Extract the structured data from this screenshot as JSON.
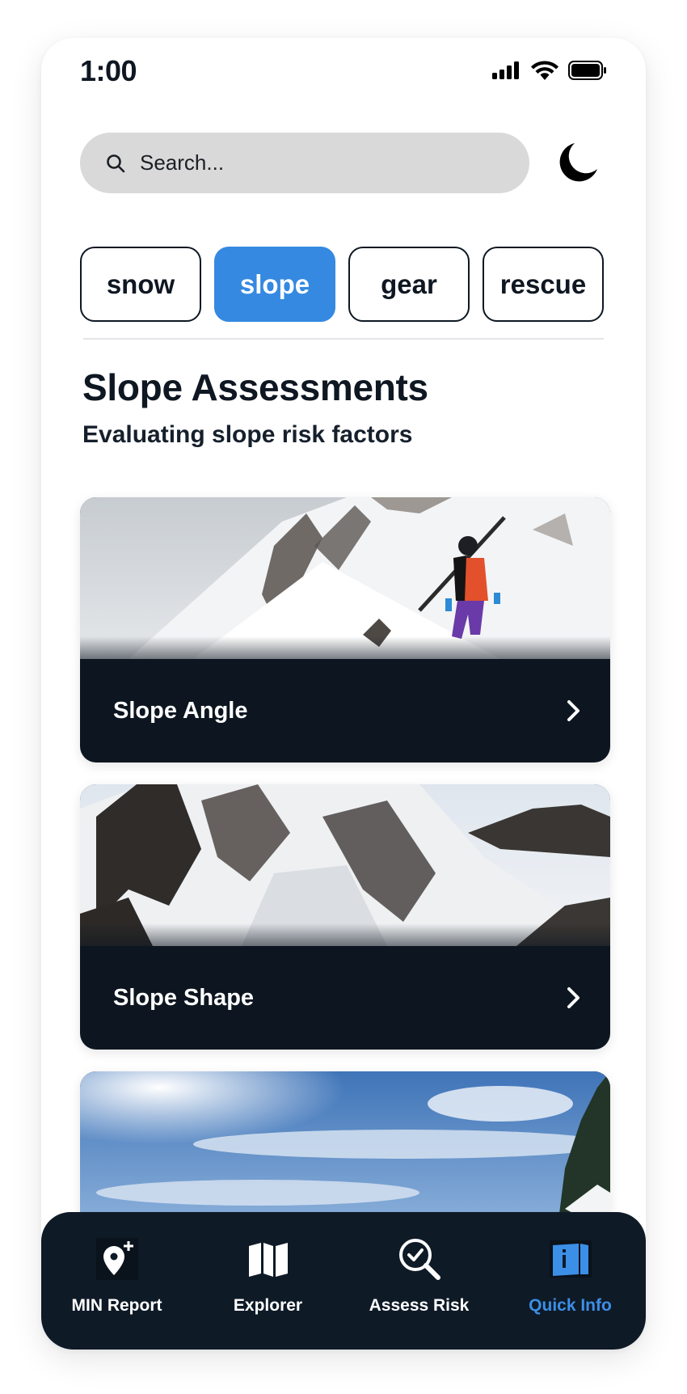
{
  "status_bar": {
    "time": "1:00"
  },
  "search": {
    "placeholder": "Search..."
  },
  "chips": [
    {
      "label": "snow",
      "active": false
    },
    {
      "label": "slope",
      "active": true
    },
    {
      "label": "gear",
      "active": false
    },
    {
      "label": "rescue",
      "active": false
    }
  ],
  "section": {
    "title": "Slope Assessments",
    "subtitle": "Evaluating slope risk factors"
  },
  "cards": [
    {
      "label": "Slope Angle",
      "image": "skier-on-snowy-slope"
    },
    {
      "label": "Slope Shape",
      "image": "snowy-mountain-ridge"
    },
    {
      "label": "",
      "image": "sunny-sky-with-trees"
    }
  ],
  "nav": [
    {
      "label": "MIN Report",
      "icon": "map-pin-plus-icon",
      "active": false
    },
    {
      "label": "Explorer",
      "icon": "map-icon",
      "active": false
    },
    {
      "label": "Assess Risk",
      "icon": "search-check-icon",
      "active": false
    },
    {
      "label": "Quick Info",
      "icon": "info-book-icon",
      "active": true
    }
  ],
  "colors": {
    "accent": "#3589e1",
    "dark": "#0f1a27",
    "search_bg": "#d9d9d9"
  }
}
